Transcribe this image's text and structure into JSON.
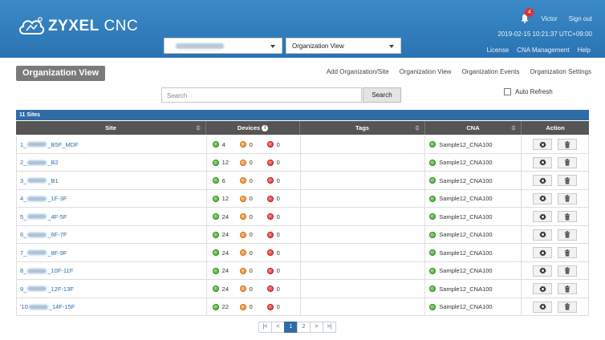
{
  "header": {
    "logo_brand": "ZYXEL",
    "logo_product": "CNC",
    "view_select": "Organization View",
    "notifications": "4",
    "user": "Victor",
    "sign_out": "Sign out",
    "timestamp": "2019-02-15 10:21:37 UTC+09:00",
    "links": [
      "License",
      "CNA Management",
      "Help"
    ]
  },
  "page": {
    "title": "Organization View",
    "subnav": [
      "Add Organization/Site",
      "Organization View",
      "Organization Events",
      "Organization Settings"
    ]
  },
  "search": {
    "placeholder": "Search",
    "button": "Search",
    "auto_refresh": "Auto Refresh"
  },
  "table": {
    "count": "11 Sites",
    "columns": [
      "Site",
      "Devices",
      "Tags",
      "CNA",
      "Action"
    ],
    "rows": [
      {
        "prefix": "1_",
        "suffix": "_B5F_MDF",
        "green": "4",
        "orange": "0",
        "red": "0",
        "cna": "Sample12_CNA100"
      },
      {
        "prefix": "2_",
        "suffix": "_B2",
        "green": "12",
        "orange": "0",
        "red": "0",
        "cna": "Sample12_CNA100"
      },
      {
        "prefix": "3_",
        "suffix": "_B1",
        "green": "6",
        "orange": "0",
        "red": "0",
        "cna": "Sample12_CNA100"
      },
      {
        "prefix": "4_",
        "suffix": "_1F-3F",
        "green": "12",
        "orange": "0",
        "red": "0",
        "cna": "Sample12_CNA100"
      },
      {
        "prefix": "5_",
        "suffix": "_4F-5F",
        "green": "24",
        "orange": "0",
        "red": "0",
        "cna": "Sample12_CNA100"
      },
      {
        "prefix": "6_",
        "suffix": "_6F-7F",
        "green": "24",
        "orange": "0",
        "red": "0",
        "cna": "Sample12_CNA100"
      },
      {
        "prefix": "7_",
        "suffix": "_8F-9F",
        "green": "24",
        "orange": "0",
        "red": "0",
        "cna": "Sample12_CNA100"
      },
      {
        "prefix": "8_",
        "suffix": "_10F-11F",
        "green": "24",
        "orange": "0",
        "red": "0",
        "cna": "Sample12_CNA100"
      },
      {
        "prefix": "9_",
        "suffix": "_12F-13F",
        "green": "24",
        "orange": "0",
        "red": "0",
        "cna": "Sample12_CNA100"
      },
      {
        "prefix": "'10",
        "suffix": "_14F-15F",
        "green": "22",
        "orange": "0",
        "red": "0",
        "cna": "Sample12_CNA100"
      }
    ]
  },
  "pagination": {
    "first": "|<",
    "prev": "<",
    "pages": [
      "1",
      "2"
    ],
    "next": ">",
    "last": ">|"
  },
  "icons": {
    "settings": "gear-icon",
    "delete": "trash-icon",
    "notifications": "bell-icon"
  },
  "colors": {
    "header_blue": "#2a73b3",
    "table_bar_blue": "#2f6ca6",
    "status_green": "#3aa32e",
    "status_orange": "#e9852a",
    "status_red": "#e02b2b"
  }
}
